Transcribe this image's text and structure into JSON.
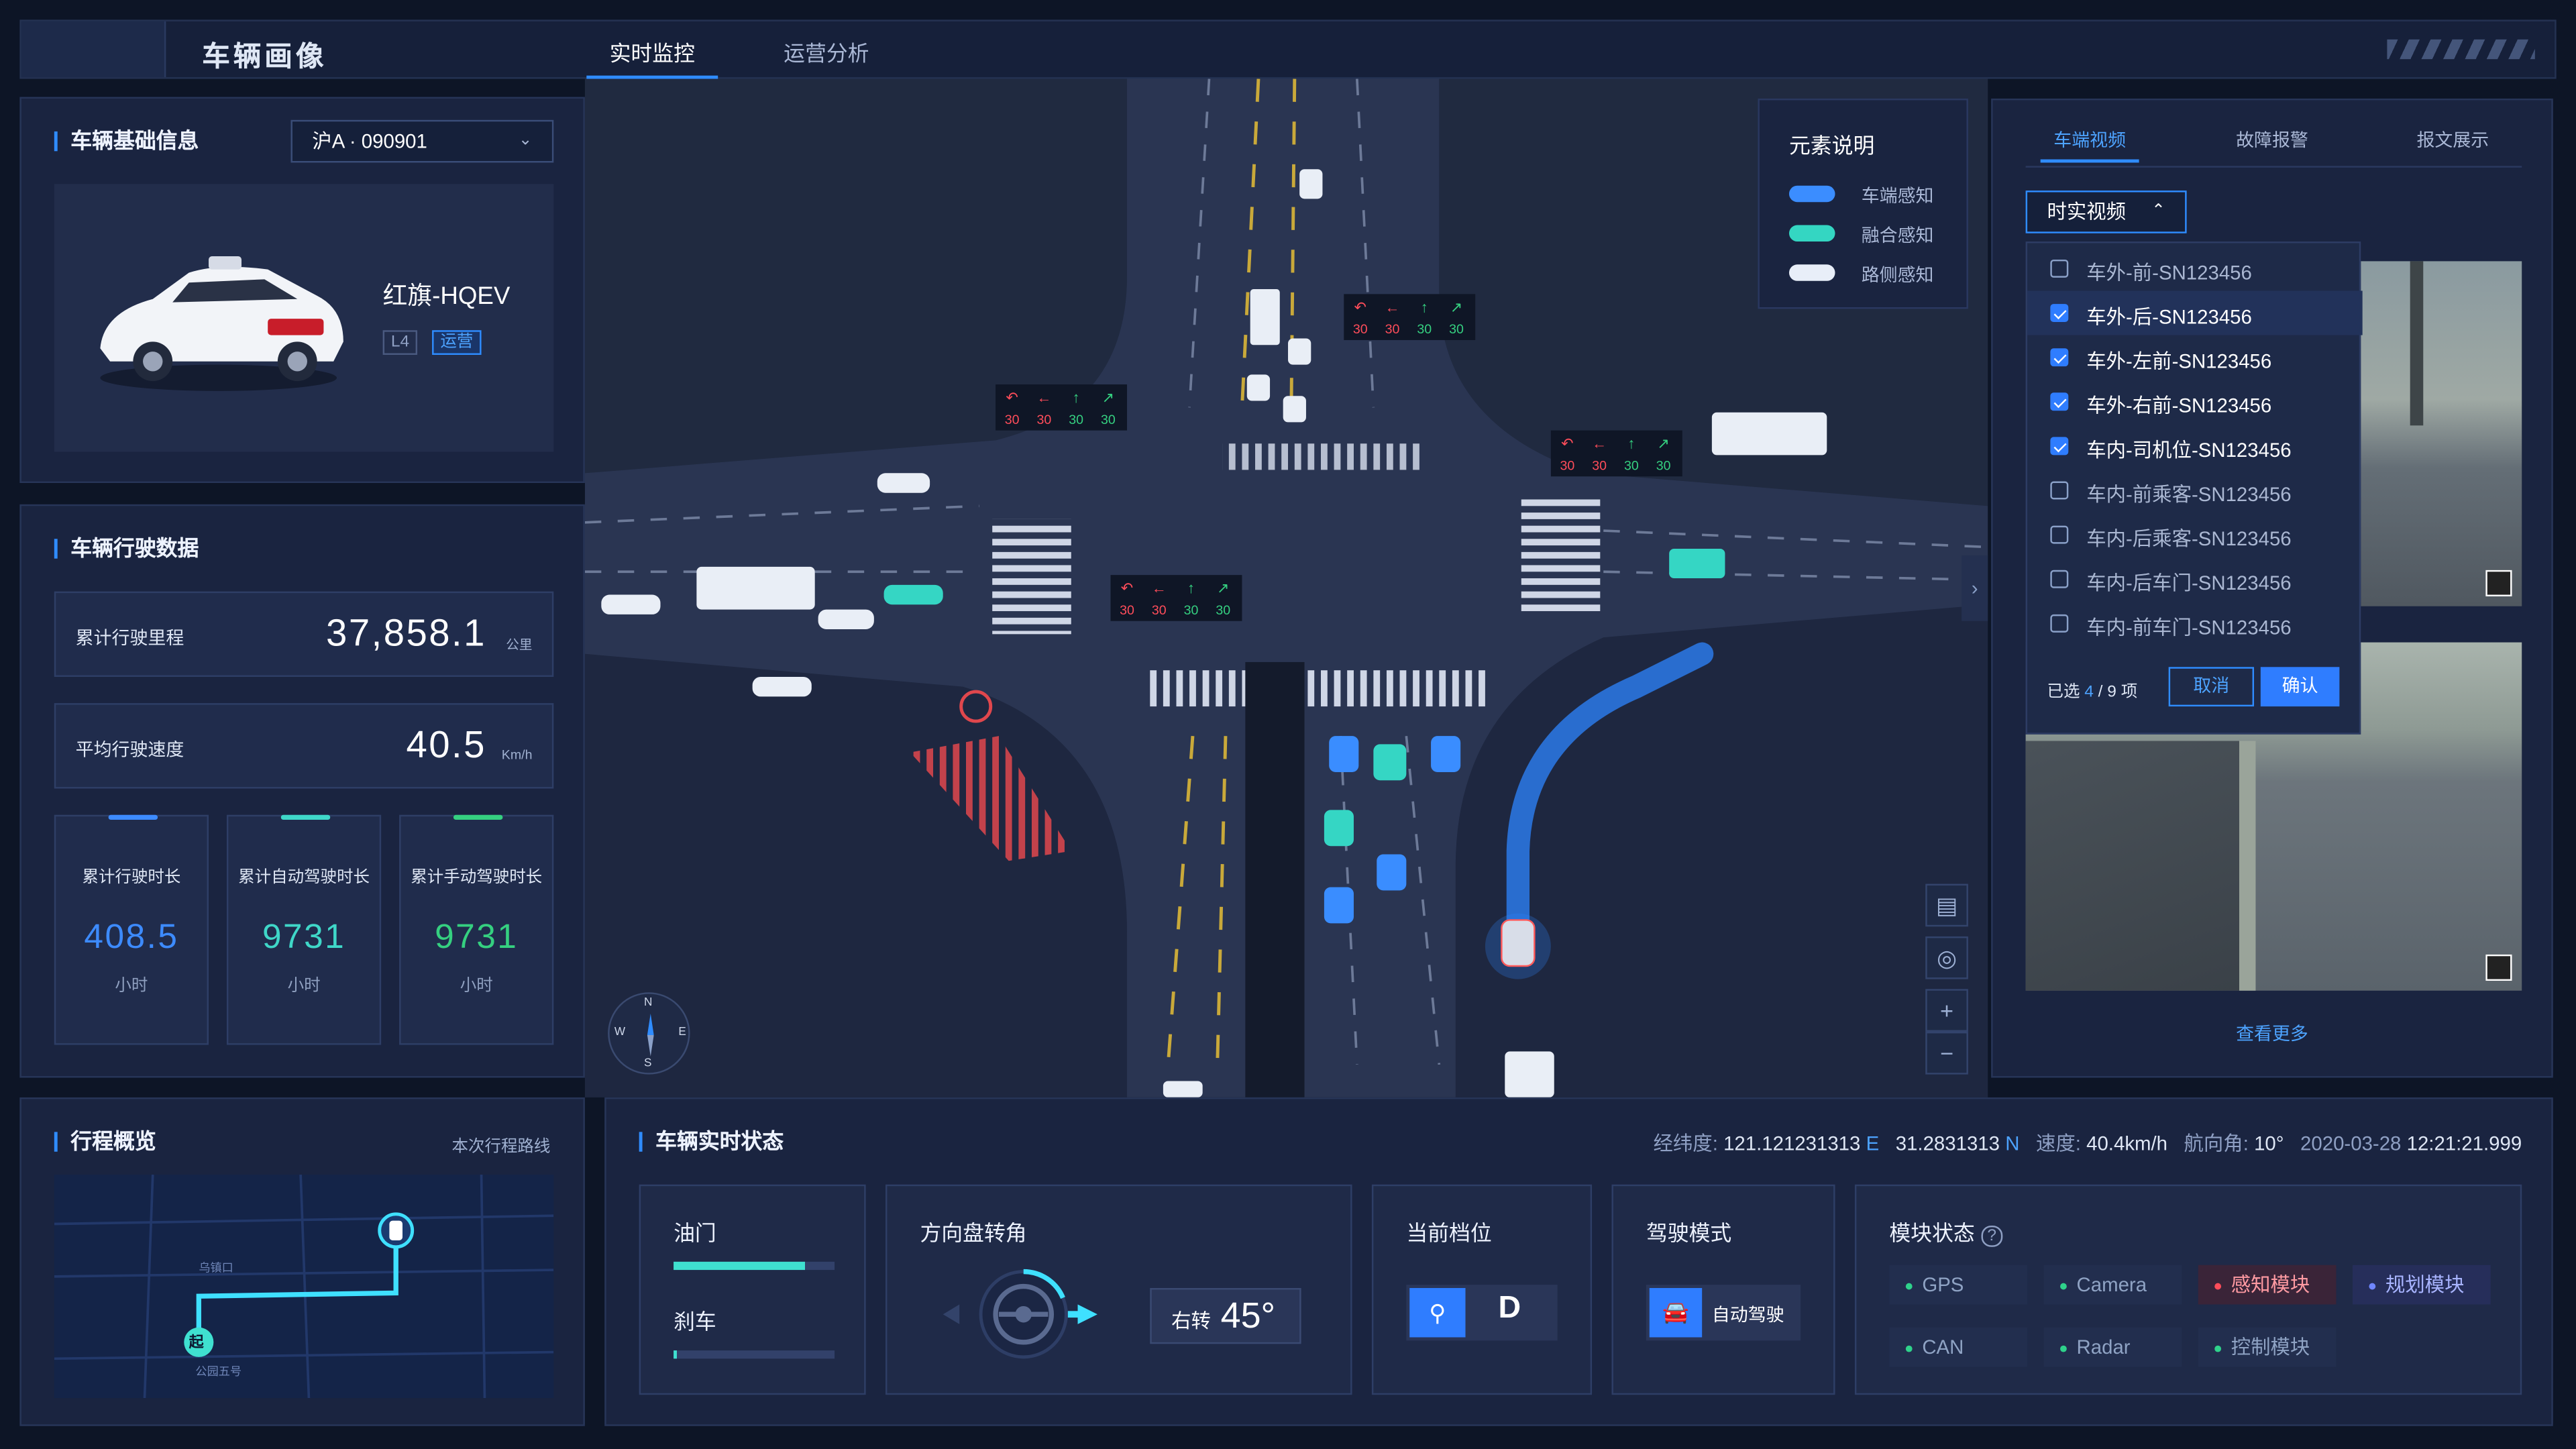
{
  "header": {
    "title": "车辆画像",
    "tabs": [
      {
        "label": "实时监控"
      },
      {
        "label": "运营分析"
      }
    ]
  },
  "basic_info": {
    "title": "车辆基础信息",
    "plate": "沪A · 090901",
    "model": "红旗-HQEV",
    "level_badge": "L4",
    "status_badge": "运营"
  },
  "driving_data": {
    "title": "车辆行驶数据",
    "metrics": [
      {
        "label": "累计行驶里程",
        "value": "37,858.1",
        "unit": "公里"
      },
      {
        "label": "平均行驶速度",
        "value": "40.5",
        "unit": "Km/h"
      }
    ],
    "stats": [
      {
        "label": "累计行驶时长",
        "value": "408.5",
        "unit": "小时",
        "color": "#3d8bff"
      },
      {
        "label": "累计自动驾驶时长",
        "value": "9731",
        "unit": "小时",
        "color": "#3fd7c8"
      },
      {
        "label": "累计手动驾驶时长",
        "value": "9731",
        "unit": "小时",
        "color": "#35d080"
      }
    ]
  },
  "trip": {
    "title": "行程概览",
    "subtitle": "本次行程路线",
    "start_label": "起",
    "road1": "乌镇口",
    "road2": "公园五号"
  },
  "legend": {
    "title": "元素说明",
    "items": [
      {
        "label": "车端感知",
        "color": "#3b8dff"
      },
      {
        "label": "融合感知",
        "color": "#34d6c2"
      },
      {
        "label": "路侧感知",
        "color": "#e8eef8"
      }
    ]
  },
  "video": {
    "tabs": [
      {
        "label": "车端视频"
      },
      {
        "label": "故障报警"
      },
      {
        "label": "报文展示"
      }
    ],
    "select": "时实视频",
    "options": [
      {
        "label": "车外-前-SN123456",
        "checked": false
      },
      {
        "label": "车外-后-SN123456",
        "checked": true
      },
      {
        "label": "车外-左前-SN123456",
        "checked": true
      },
      {
        "label": "车外-右前-SN123456",
        "checked": true
      },
      {
        "label": "车内-司机位-SN123456",
        "checked": true
      },
      {
        "label": "车内-前乘客-SN123456",
        "checked": false
      },
      {
        "label": "车内-后乘客-SN123456",
        "checked": false
      },
      {
        "label": "车内-后车门-SN123456",
        "checked": false
      },
      {
        "label": "车内-前车门-SN123456",
        "checked": false
      }
    ],
    "selected_prefix": "已选",
    "selected_count": "4",
    "selected_total": "/ 9 项",
    "cancel": "取消",
    "confirm": "确认",
    "more": "查看更多"
  },
  "map": {
    "compass": {
      "n": "N",
      "s": "S",
      "w": "W",
      "e": "E"
    },
    "signal_value": "30",
    "zoom_in": "+",
    "zoom_out": "−"
  },
  "realtime": {
    "title": "车辆实时状态",
    "lng_label": "经纬度:",
    "lng": "121.121231313",
    "lng_dir": "E",
    "lat": "31.2831313",
    "lat_dir": "N",
    "speed_label": "速度:",
    "speed": "40.4km/h",
    "heading_label": "航向角:",
    "heading": "10°",
    "date": "2020-03-28",
    "time": "12:21:21.999",
    "throttle_label": "油门",
    "throttle_level": 0.82,
    "brake_label": "刹车",
    "brake_level": 0.0,
    "steer_label": "方向盘转角",
    "steer_dir": "右转",
    "steer_angle": "45°",
    "gear_label": "当前档位",
    "gear": "D",
    "mode_label": "驾驶模式",
    "mode": "自动驾驶",
    "modules_label": "模块状态",
    "modules": [
      {
        "label": "GPS",
        "status": "ok"
      },
      {
        "label": "Camera",
        "status": "ok"
      },
      {
        "label": "感知模块",
        "status": "error"
      },
      {
        "label": "规划模块",
        "status": "info"
      },
      {
        "label": "CAN",
        "status": "ok"
      },
      {
        "label": "Radar",
        "status": "ok"
      },
      {
        "label": "控制模块",
        "status": "ok"
      }
    ]
  },
  "colors": {
    "accent": "#2f8cff",
    "ok": "#2fd28b",
    "error": "#ff4d5a",
    "info": "#6f86ff",
    "cyan": "#3fe0d0"
  }
}
